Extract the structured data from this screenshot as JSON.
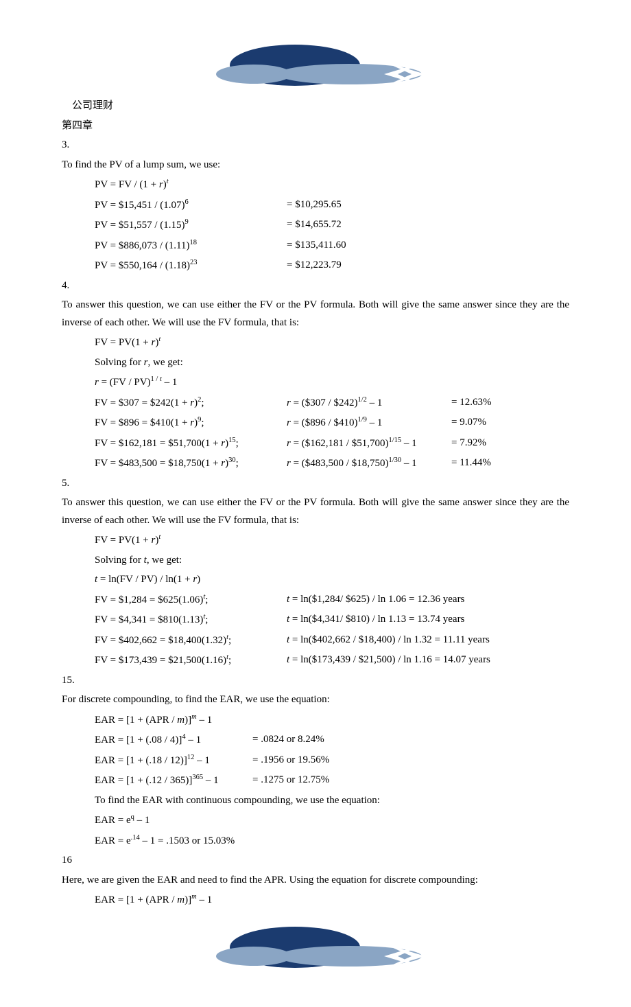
{
  "header": {
    "title_cn": "公司理财",
    "chapter": "第四章"
  },
  "q3": {
    "num": "3.",
    "intro": "To find the PV of a lump sum, we use:",
    "formula_lhs": "PV = FV / (1 + ",
    "formula_mid_close": ")",
    "rows": [
      {
        "lhs_a": "PV = $15,451 / (1.07)",
        "lhs_sup": "6",
        "rhs": "= $10,295.65"
      },
      {
        "lhs_a": "PV = $51,557 / (1.15)",
        "lhs_sup": "9",
        "rhs": "= $14,655.72"
      },
      {
        "lhs_a": "PV = $886,073 / (1.11)",
        "lhs_sup": "18",
        "rhs": "= $135,411.60"
      },
      {
        "lhs_a": "PV = $550,164 / (1.18)",
        "lhs_sup": "23",
        "rhs": "= $12,223.79"
      }
    ]
  },
  "q4": {
    "num": "4.",
    "intro": "To answer this question, we can use either the FV or the PV formula. Both will give the same answer since they are the inverse of each other. We will use the FV formula, that is:",
    "formula1_pre": "FV = PV(1 + ",
    "solving": "Solving for ",
    "solving_tail": ", we get:",
    "formula2_pre": " = (FV / PV)",
    "formula2_sup": "1 / ",
    "formula2_tail": " – 1",
    "rows": [
      {
        "a1": "FV = $307 = $242(1 + ",
        "a2": ")",
        "asup": "2",
        "atail": ";",
        "b1": " = ($307 / $242)",
        "bsup": "1/2",
        "btail": " – 1",
        "c": "= 12.63%"
      },
      {
        "a1": "FV = $896 = $410(1 + ",
        "a2": ")",
        "asup": "9",
        "atail": ";",
        "b1": " = ($896 / $410)",
        "bsup": "1/9",
        "btail": " – 1",
        "c": "= 9.07%"
      },
      {
        "a1": "FV = $162,181 = $51,700(1 + ",
        "a2": ")",
        "asup": "15",
        "atail": ";",
        "b1": " = ($162,181 / $51,700)",
        "bsup": "1/15",
        "btail": " – 1",
        "c": "= 7.92%"
      },
      {
        "a1": "FV = $483,500 = $18,750(1 + ",
        "a2": ")",
        "asup": "30",
        "atail": ";",
        "b1": " = ($483,500 / $18,750)",
        "bsup": "1/30",
        "btail": " – 1",
        "c": "= 11.44%"
      }
    ]
  },
  "q5": {
    "num": "5.",
    "intro": "To answer this question, we can use either the FV or the PV formula. Both will give the same answer since they are the inverse of each other. We will use the FV formula, that is:",
    "formula1_pre": "FV = PV(1 + ",
    "solving": "Solving for ",
    "solving_tail": ", we get:",
    "formula2_pre": " = ln(FV / PV) / ln(1 + ",
    "formula2_tail": ")",
    "rows": [
      {
        "a1": "FV = $1,284 = $625(1.06)",
        "atail": ";",
        "b": " = ln($1,284/ $625) / ln 1.06 = 12.36 years"
      },
      {
        "a1": "FV = $4,341 = $810(1.13)",
        "atail": ";",
        "b": " = ln($4,341/ $810) / ln 1.13 = 13.74 years"
      },
      {
        "a1": "FV = $402,662 = $18,400(1.32)",
        "atail": ";",
        "b": " = ln($402,662 / $18,400) / ln 1.32 = 11.11 years"
      },
      {
        "a1": "FV = $173,439 = $21,500(1.16)",
        "atail": ";",
        "b": " = ln($173,439 / $21,500) / ln 1.16 = 14.07 years"
      }
    ]
  },
  "q15": {
    "num": "15.",
    "intro": "For discrete compounding, to find the EAR, we use the equation:",
    "formula_a": "EAR = [1 + (APR / ",
    "formula_b": ")]",
    "formula_c": " – 1",
    "rows": [
      {
        "a": "EAR = [1 + (.08 / 4)]",
        "sup": "4",
        "tail": " – 1",
        "r": "= .0824 or 8.24%"
      },
      {
        "a": "EAR = [1 + (.18 / 12)]",
        "sup": "12",
        "tail": " – 1",
        "r": "= .1956 or 19.56%"
      },
      {
        "a": "EAR = [1 + (.12 / 365)]",
        "sup": "365",
        "tail": " – 1",
        "r": "= .1275 or 12.75%"
      }
    ],
    "cont_intro": "To find the EAR with continuous compounding, we use the equation:",
    "cont_f1a": "EAR = e",
    "cont_f1sup": "q",
    "cont_f1tail": " – 1",
    "cont_f2a": "EAR = e",
    "cont_f2sup": ".14",
    "cont_f2tail": " – 1 = .1503 or 15.03%"
  },
  "q16": {
    "num": "16",
    "intro": "Here, we are given the EAR and need to find the APR. Using the equation for discrete compounding:",
    "formula_a": "EAR = [1 + (APR / ",
    "formula_b": ")]",
    "formula_c": " – 1"
  }
}
